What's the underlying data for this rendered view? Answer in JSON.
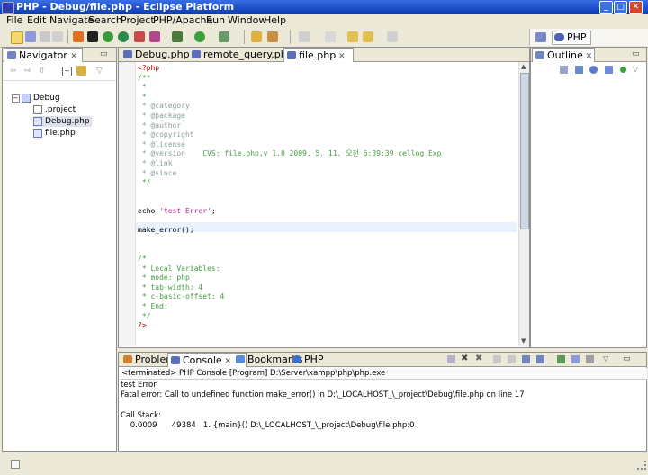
{
  "window": {
    "title": "PHP - Debug/file.php - Eclipse Platform",
    "min": "_",
    "max": "□",
    "close": "✕"
  },
  "menu": [
    "File",
    "Edit",
    "Navigate",
    "Search",
    "Project",
    "PHP/Apache",
    "Run",
    "Window",
    "Help"
  ],
  "perspective": {
    "label": "PHP"
  },
  "navigator": {
    "tab": "Navigator",
    "tree": {
      "root": "Debug",
      "items": [
        ".project",
        "Debug.php",
        "file.php"
      ]
    }
  },
  "editor": {
    "tabs": [
      "Debug.php",
      "remote_query.php",
      "file.php"
    ],
    "lines": [
      {
        "t": "<?php",
        "c": "red"
      },
      {
        "t": "/**",
        "c": "green"
      },
      {
        "t": " *",
        "c": "green"
      },
      {
        "t": " *",
        "c": "green"
      },
      {
        "t": " * @category",
        "c": "grey"
      },
      {
        "t": " * @package",
        "c": "grey"
      },
      {
        "t": " * @author",
        "c": "grey"
      },
      {
        "t": " * @copyright",
        "c": "grey"
      },
      {
        "t": " * @license",
        "c": "grey"
      },
      {
        "t": " * @version    CVS: file.php,v 1.0 2009. 5. 11. 오전 6:39:39 cellog Exp",
        "c": "grey-green"
      },
      {
        "t": " * @link",
        "c": "grey"
      },
      {
        "t": " * @since",
        "c": "grey"
      },
      {
        "t": " */",
        "c": "green"
      },
      {
        "t": "",
        "c": ""
      },
      {
        "t": "",
        "c": ""
      },
      {
        "t": "echo 'test Error';",
        "c": "echo"
      },
      {
        "t": "",
        "c": ""
      },
      {
        "t": "make_error();",
        "c": "plain"
      },
      {
        "t": "",
        "c": ""
      },
      {
        "t": "",
        "c": ""
      },
      {
        "t": "/*",
        "c": "green"
      },
      {
        "t": " * Local Variables:",
        "c": "green"
      },
      {
        "t": " * mode: php",
        "c": "green"
      },
      {
        "t": " * tab-width: 4",
        "c": "green"
      },
      {
        "t": " * c-basic-offset: 4",
        "c": "green"
      },
      {
        "t": " * End:",
        "c": "green"
      },
      {
        "t": " */",
        "c": "green"
      },
      {
        "t": "?>",
        "c": "red"
      }
    ]
  },
  "outline": {
    "tab": "Outline"
  },
  "bottom": {
    "tabs": [
      "Problems",
      "Console",
      "Bookmarks",
      "PHP Browser"
    ],
    "header": "<terminated> PHP Console [Program] D:\\Server\\xampp\\php\\php.exe",
    "output": [
      "test Error",
      "Fatal error: Call to undefined function make_error() in D:\\_LOCALHOST_\\_project\\Debug\\file.php on line 17",
      "",
      "Call Stack:",
      "    0.0009      49384   1. {main}() D:\\_LOCALHOST_\\_project\\Debug\\file.php:0"
    ]
  },
  "colors": {
    "accent": "#1c4fc8",
    "highlight_line": "#e8f2fe",
    "comment": "#3f9f3f",
    "keyword": "#c00000",
    "string": "#c0208a"
  }
}
